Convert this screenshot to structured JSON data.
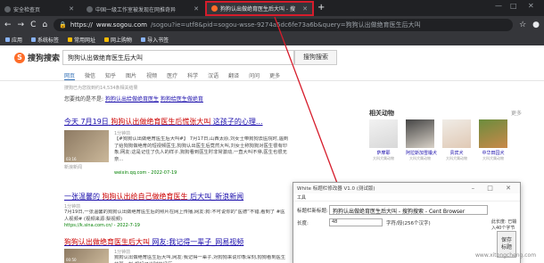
{
  "browser": {
    "tabs": [
      {
        "label": "安全检查页",
        "active": false
      },
      {
        "label": "中国一级工作室被发现在网推奇异",
        "active": false
      },
      {
        "label": "狗狗认出做绝育医生后大叫 - 搜",
        "active": true
      }
    ],
    "new_tab": "+",
    "window_controls": [
      "—",
      "□",
      "✕"
    ],
    "nav": {
      "back": "←",
      "forward": "→",
      "reload": "C",
      "home": "⌂"
    },
    "url": {
      "scheme": "https://",
      "host": "www.sogou.com",
      "rest": "/sogou?ie=utf8&pid=sogou-wsse-9274a5dc6fe73a6b&query=狗狗认出做绝育医生后大叫"
    },
    "bookmarks": [
      "应用",
      "系统标签",
      "常用网址",
      "网上购物",
      "导入书签"
    ]
  },
  "sogou": {
    "logo": "搜狗搜索",
    "query": "狗狗认出做绝育医生后大叫",
    "search_button": "搜狗搜索",
    "categories": [
      "网页",
      "微信",
      "知乎",
      "图片",
      "视频",
      "医疗",
      "科学",
      "汉语",
      "翻译",
      "问问",
      "更多"
    ],
    "result_info": "搜狗已为您找到约14,534条相关结果",
    "hint_prefix": "您要找的是不是:",
    "hint_links": [
      "狗狗认出给做绝育医生",
      "狗狗给医生做绝育"
    ],
    "results": [
      {
        "title": "今天 7月19日",
        "title_em": "狗狗认出做绝育医生后慌张大叫",
        "title_tail": " 这孩子的心理...",
        "meta": "1分钟前",
        "text": "【#狗狗认出做绝育医生后大叫#】 7月17日,山西太原,刘女士带狗狗去医院时,遇到了给狗狗做绝育的短视频医生,狗狗认出医生后竟然大叫,刘女士称狗狗对医生很有印象,网友:这是记住了仇人的样子,狗狗看到医生时非常激动,一直大叫不停,医生也很无奈...",
        "url": "weixin.qq.com - 2022-07-19",
        "source": "新浪新闻"
      },
      {
        "title": "一张温馨的",
        "title_em": "狗狗认出给自己做绝育医生",
        "title_tail": "后大叫_新浪新闻",
        "meta": "1分钟前",
        "text": "7月19日,一张温馨的狗狗认出做绝育医生后的照片在网上传播,网友:狗:不可说你的“医德”不错,看到了 #医人视频# (视频来源:梨视频)",
        "url": "https://k.sina.com.cn/ - 2022-7-19"
      },
      {
        "title": "",
        "title_em": "狗狗认出做绝育医生后大叫",
        "title_tail": " 网友:我记得一辈子_网易视频",
        "meta": "1分钟前",
        "text": "狗狗认出做绝育医生后大叫,网友:我记得一辈子,对狗狗来说印象深刻,狗狗看到医生的那一刻,想起了当时的经历..."
      }
    ],
    "thumb_labels": [
      "03:16",
      "00:50"
    ],
    "related": {
      "title": "相关动物",
      "more": "更多",
      "items": [
        {
          "name": "萨摩耶",
          "sub": "大科犬属动物"
        },
        {
          "name": "阿拉斯加雪橇犬",
          "sub": "大科犬属动物"
        },
        {
          "name": "贵宾犬",
          "sub": "大科犬属动物"
        },
        {
          "name": "中华田园犬",
          "sub": "大科犬属动物"
        }
      ]
    }
  },
  "popup": {
    "title": "White 标题栏修改器 V1.0 (测试版)",
    "menu": "工具",
    "label_new_title": "标题栏新标题:",
    "new_title": "狗狗认出做绝育医生后大叫 - 搜狗搜索 - Cent Browser",
    "side_note": "此长度: 已输入40个字节",
    "label_length": "长度:",
    "length_value": "48",
    "length_note": "字符/段(256个汉字)",
    "save": [
      "保存",
      "标题"
    ]
  },
  "watermark": "www.xitongcheng.com",
  "colors": {
    "highlight": "#d61c2b",
    "link": "#1a0dab",
    "keyword": "#cc0000"
  }
}
